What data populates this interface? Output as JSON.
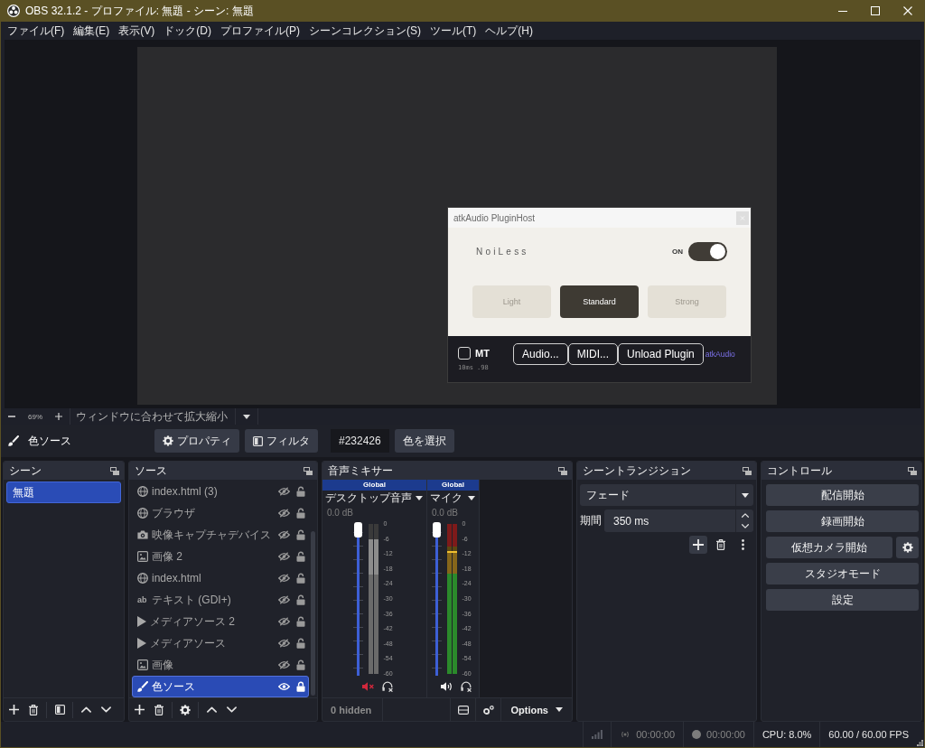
{
  "window": {
    "title": "OBS 32.1.2 - プロファイル: 無題 - シーン: 無題"
  },
  "menu": [
    "ファイル(F)",
    "編集(E)",
    "表示(V)",
    "ドック(D)",
    "プロファイル(P)",
    "シーンコレクション(S)",
    "ツール(T)",
    "ヘルプ(H)"
  ],
  "plugin_dialog": {
    "title": "atkAudio PluginHost",
    "plugin_name": "NoiLess",
    "power": {
      "label": "ON",
      "on": true
    },
    "modes": [
      {
        "label": "Light",
        "selected": false
      },
      {
        "label": "Standard",
        "selected": true
      },
      {
        "label": "Strong",
        "selected": false
      }
    ],
    "mt": {
      "label": "MT",
      "checked": false
    },
    "latency": "10ms .98",
    "buttons": [
      "Audio...",
      "MIDI...",
      "Unload Plugin"
    ],
    "brand": "atkAudio"
  },
  "zoom_bar": {
    "zoom": "69%",
    "fit_mode": "ウィンドウに合わせて拡大縮小"
  },
  "source_toolbar": {
    "source_name": "色ソース",
    "buttons": [
      {
        "label": "プロパティ",
        "kind": "properties"
      },
      {
        "label": "フィルタ",
        "kind": "filters"
      }
    ],
    "color_value": "#232426",
    "pick_label": "色を選択"
  },
  "scenes": {
    "title": "シーン",
    "items": [
      {
        "label": "無題",
        "selected": true
      }
    ]
  },
  "sources": {
    "title": "ソース",
    "items": [
      {
        "label": "index.html (3)",
        "kind": "browser",
        "visible": false,
        "locked": false,
        "selected": false
      },
      {
        "label": "ブラウザ",
        "kind": "browser",
        "visible": false,
        "locked": false,
        "selected": false
      },
      {
        "label": "映像キャプチャデバイス",
        "kind": "camera",
        "visible": false,
        "locked": false,
        "selected": false
      },
      {
        "label": "画像 2",
        "kind": "image",
        "visible": false,
        "locked": false,
        "selected": false
      },
      {
        "label": "index.html",
        "kind": "browser",
        "visible": false,
        "locked": false,
        "selected": false
      },
      {
        "label": "テキスト (GDI+)",
        "kind": "text",
        "glyph": "ab",
        "visible": false,
        "locked": false,
        "selected": false
      },
      {
        "label": "メディアソース 2",
        "kind": "media",
        "visible": false,
        "locked": false,
        "selected": false
      },
      {
        "label": "メディアソース",
        "kind": "media",
        "visible": false,
        "locked": false,
        "selected": false
      },
      {
        "label": "画像",
        "kind": "image",
        "visible": false,
        "locked": false,
        "selected": false
      },
      {
        "label": "色ソース",
        "kind": "color",
        "visible": true,
        "locked": true,
        "selected": true
      }
    ]
  },
  "audio_mixer": {
    "title": "音声ミキサー",
    "channels": [
      {
        "scope": "Global",
        "name": "デスクトップ音声",
        "reading": "0.0 dB",
        "fader": {
          "level": 1
        },
        "meter": {
          "level": 0.9
        },
        "muted": true,
        "scale": [
          "0",
          "-6",
          "-12",
          "-18",
          "-24",
          "-30",
          "-36",
          "-42",
          "-48",
          "-54",
          "-60"
        ]
      },
      {
        "scope": "Global",
        "name": "マイク",
        "reading": "0.0 dB",
        "fader": {
          "level": 1
        },
        "meter": {
          "level": 0.82
        },
        "muted": false,
        "scale": [
          "0",
          "-6",
          "-12",
          "-18",
          "-24",
          "-30",
          "-36",
          "-42",
          "-48",
          "-54",
          "-60"
        ]
      }
    ],
    "hidden_count": "0 hidden",
    "options": "Options"
  },
  "transitions": {
    "title": "シーントランジション",
    "type": "フェード",
    "duration_label": "期間",
    "duration": "350 ms"
  },
  "controls": {
    "title": "コントロール",
    "buttons": [
      {
        "label": "配信開始",
        "kind": "plain"
      },
      {
        "label": "録画開始",
        "kind": "plain"
      },
      {
        "label": "仮想カメラ開始",
        "kind": "with_settings"
      },
      {
        "label": "スタジオモード",
        "kind": "plain"
      },
      {
        "label": "設定",
        "kind": "plain"
      }
    ]
  },
  "status_bar": {
    "stream_time": "00:00:00",
    "record_time": "00:00:00",
    "cpu": "CPU: 8.0%",
    "fps": "60.00 / 60.00 FPS"
  }
}
